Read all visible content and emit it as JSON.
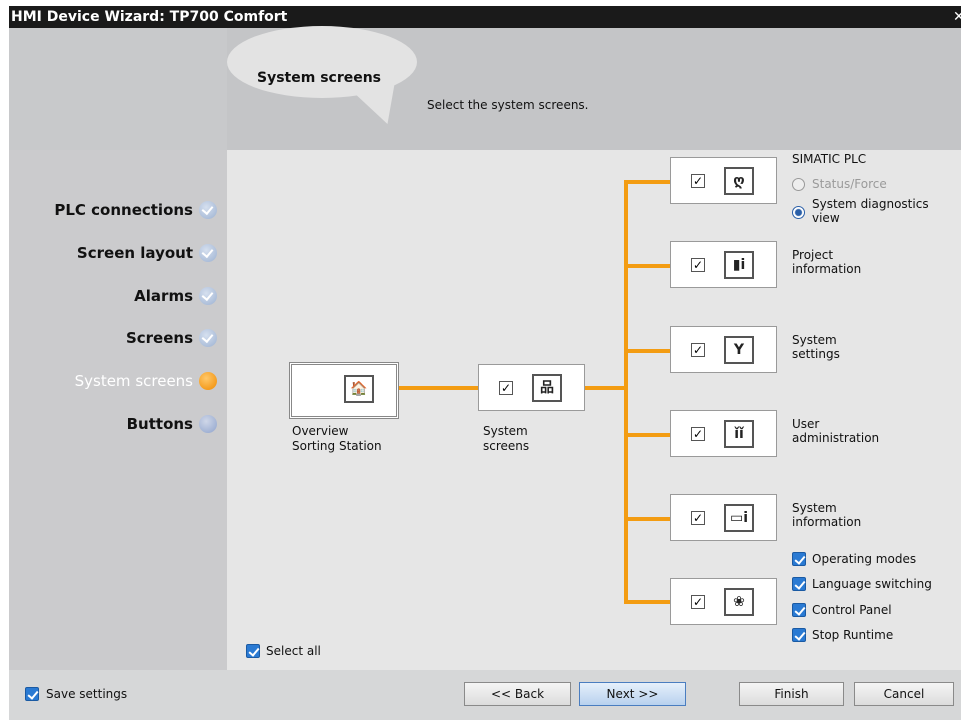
{
  "window": {
    "title": "HMI Device Wizard: TP700 Comfort",
    "close_glyph": "✕"
  },
  "header": {
    "title": "System screens",
    "subtitle": "Select the system screens."
  },
  "steps": [
    {
      "label": "PLC connections",
      "state": "done"
    },
    {
      "label": "Screen layout",
      "state": "done"
    },
    {
      "label": "Alarms",
      "state": "done"
    },
    {
      "label": "Screens",
      "state": "done"
    },
    {
      "label": "System screens",
      "state": "current"
    },
    {
      "label": "Buttons",
      "state": "pending"
    }
  ],
  "tree": {
    "root": {
      "label_line1": "Overview",
      "label_line2": "Sorting Station",
      "icon": "home-icon",
      "glyph": "🏠"
    },
    "system": {
      "label_line1": "System",
      "label_line2": "screens",
      "icon": "network-icon",
      "glyph": "品",
      "checked": true
    },
    "children": [
      {
        "id": "plc",
        "glyph": "ღ",
        "icon": "stethoscope-icon",
        "checked": true
      },
      {
        "id": "project",
        "glyph": "▮i",
        "icon": "document-info-icon",
        "checked": true
      },
      {
        "id": "settings",
        "glyph": "Y",
        "icon": "wrench-icon",
        "checked": true
      },
      {
        "id": "users",
        "glyph": "ǐǐ",
        "icon": "users-icon",
        "checked": true
      },
      {
        "id": "sysinfo",
        "glyph": "▭i",
        "icon": "monitor-info-icon",
        "checked": true
      },
      {
        "id": "misc",
        "glyph": "❀",
        "icon": "settings-globe-icon",
        "checked": true
      }
    ]
  },
  "labels": {
    "plc_title": "SIMATIC PLC",
    "status_force": "Status/Force",
    "system_diag_line1": "System diagnostics",
    "system_diag_line2": "view",
    "project_line1": "Project",
    "project_line2": "information",
    "settings_line1": "System",
    "settings_line2": "settings",
    "users_line1": "User",
    "users_line2": "administration",
    "sysinfo_line1": "System",
    "sysinfo_line2": "information"
  },
  "options": [
    {
      "label": "Operating modes",
      "checked": true
    },
    {
      "label": "Language switching",
      "checked": true
    },
    {
      "label": "Control Panel",
      "checked": true
    },
    {
      "label": "Stop Runtime",
      "checked": true
    }
  ],
  "select_all": {
    "label": "Select all",
    "checked": true
  },
  "footer": {
    "save_settings": "Save settings",
    "back": "<< Back",
    "next": "Next >>",
    "finish": "Finish",
    "cancel": "Cancel"
  },
  "colors": {
    "accent_orange": "#f39c12",
    "checkbox_blue": "#2a7ad3"
  }
}
